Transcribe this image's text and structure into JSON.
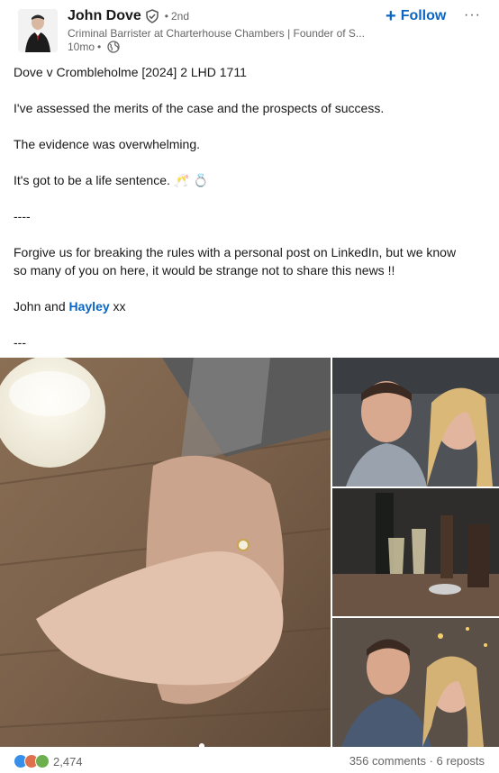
{
  "author": {
    "name": "John Dove",
    "degree": "2nd",
    "headline": "Criminal Barrister at Charterhouse Chambers | Founder of S...",
    "time": "10mo",
    "follow_label": "Follow",
    "verified_icon": "verified-shield-icon",
    "visibility_icon": "globe-icon",
    "more_label": "···"
  },
  "post": {
    "line1": "Dove v Crombleholme [2024] 2 LHD 1711",
    "line2": "I've assessed the merits of the case and the prospects of success.",
    "line3": "The evidence was overwhelming.",
    "line4": "It's got to be a life sentence. 🥂 💍",
    "sep1": "----",
    "line5a": "Forgive us for breaking the rules with a personal post on LinkedIn, but we know",
    "line5b": "so many of you on here, it would be strange not to share this news !!",
    "sign_pre": "John and ",
    "sign_mention": "Hayley",
    "sign_post": " xx",
    "sep2": "---"
  },
  "footer": {
    "reaction_count": "2,474",
    "stats": "356 comments · 6 reposts",
    "reaction_icons": [
      "like-icon",
      "love-icon",
      "support-icon"
    ]
  },
  "colors": {
    "accent": "#0a66c2",
    "text": "#191919",
    "muted": "#666666"
  }
}
